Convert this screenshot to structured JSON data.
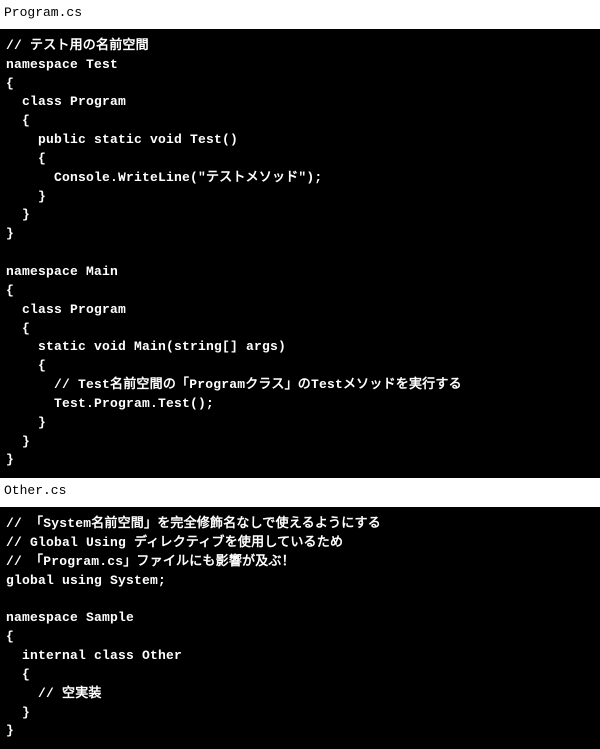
{
  "files": [
    {
      "name": "Program.cs",
      "code": "// テスト用の名前空間\nnamespace Test\n{\n  class Program\n  {\n    public static void Test()\n    {\n      Console.WriteLine(\"テストメソッド\");\n    }\n  }\n}\n\nnamespace Main\n{\n  class Program\n  {\n    static void Main(string[] args)\n    {\n      // Test名前空間の「Programクラス」のTestメソッドを実行する\n      Test.Program.Test();\n    }\n  }\n}"
    },
    {
      "name": "Other.cs",
      "code": "// 「System名前空間」を完全修飾名なしで使えるようにする\n// Global Using ディレクティブを使用しているため\n// 「Program.cs」ファイルにも影響が及ぶ！\nglobal using System;\n\nnamespace Sample\n{\n  internal class Other\n  {\n    // 空実装\n  }\n}"
    }
  ]
}
